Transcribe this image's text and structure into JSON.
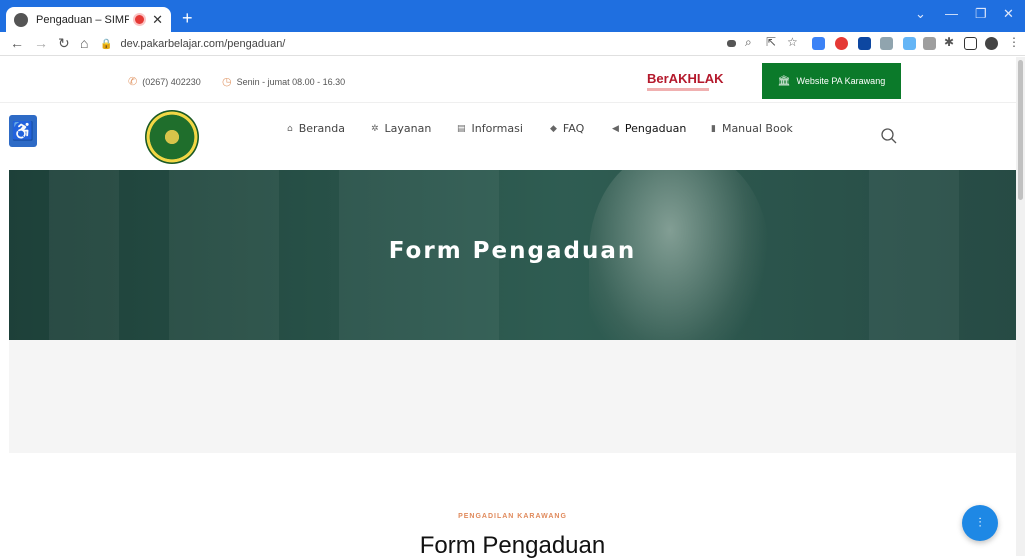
{
  "browser": {
    "tab_title": "Pengaduan – SIMPELIN – Pe",
    "url": "dev.pakarbelajar.com/pengaduan/"
  },
  "topbar": {
    "phone": "(0267) 402230",
    "hours": "Senin - jumat 08.00 - 16.30",
    "brand_logo_text": "BerAKHLAK",
    "website_button": "Website PA Karawang"
  },
  "nav": {
    "items": [
      {
        "label": "Beranda",
        "icon": "home-icon"
      },
      {
        "label": "Layanan",
        "icon": "gear-icon"
      },
      {
        "label": "Informasi",
        "icon": "info-icon"
      },
      {
        "label": "FAQ",
        "icon": "chat-icon"
      },
      {
        "label": "Pengaduan",
        "icon": "megaphone-icon"
      },
      {
        "label": "Manual Book",
        "icon": "book-icon"
      }
    ],
    "active": "Pengaduan"
  },
  "hero": {
    "title": "Form Pengaduan"
  },
  "section": {
    "kicker": "PENGADILAN KARAWANG",
    "title": "Form Pengaduan"
  },
  "colors": {
    "brand_green": "#0b7a2a",
    "accent_orange": "#e08a5c",
    "chrome_blue": "#1f6fe0",
    "voice_blue": "#1e88e5"
  }
}
